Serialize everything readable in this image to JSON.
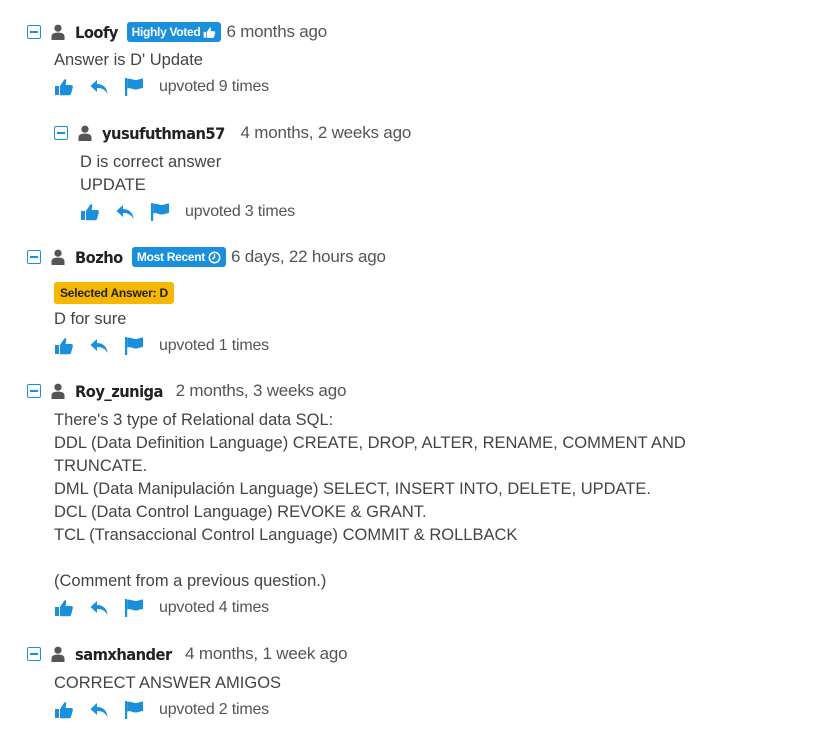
{
  "colors": {
    "accent": "#1a8fdc",
    "selected_badge": "#f5b700"
  },
  "comments": [
    {
      "username": "Loofy",
      "badge": "Highly Voted",
      "badge_icon": "thumbs-up-icon",
      "date": "6 months ago",
      "lines": [
        "Answer is D' Update"
      ],
      "votes": "upvoted 9 times"
    },
    {
      "username": "yusufuthman57",
      "date": "4 months, 2 weeks ago",
      "lines": [
        "D is correct answer",
        "UPDATE"
      ],
      "votes": "upvoted 3 times"
    },
    {
      "username": "Bozho",
      "badge": "Most Recent",
      "badge_icon": "clock-icon",
      "date": "6 days, 22 hours ago",
      "selected_answer": "Selected Answer: D",
      "lines": [
        "D for sure"
      ],
      "votes": "upvoted 1 times"
    },
    {
      "username": "Roy_zuniga",
      "date": "2 months, 3 weeks ago",
      "lines": [
        "There's 3 type of Relational data SQL:",
        "DDL (Data Definition Language) CREATE, DROP, ALTER, RENAME, COMMENT AND",
        "TRUNCATE.",
        "DML (Data Manipulación Language) SELECT, INSERT INTO, DELETE, UPDATE.",
        "DCL (Data Control Language) REVOKE & GRANT.",
        "TCL (Transaccional Control Language) COMMIT & ROLLBACK",
        "",
        "(Comment from a previous question.)"
      ],
      "votes": "upvoted 4 times"
    },
    {
      "username": "samxhander",
      "date": "4 months, 1 week ago",
      "lines": [
        "CORRECT ANSWER AMIGOS"
      ],
      "votes": "upvoted 2 times"
    }
  ]
}
